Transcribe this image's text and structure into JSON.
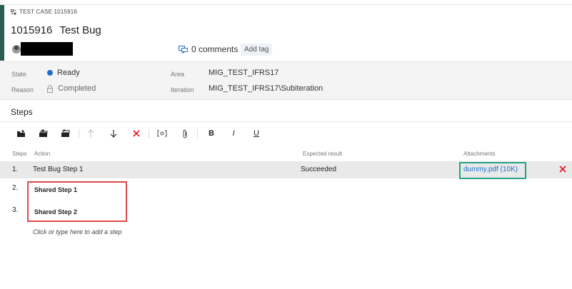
{
  "workitem": {
    "type_label": "TEST CASE 1015916",
    "type_icon": "test-case-icon",
    "id": "1015916",
    "title": "Test Bug",
    "comments": "0 comments",
    "add_tag": "Add tag"
  },
  "fields": {
    "state_label": "State",
    "state_value": "Ready",
    "state_color": "#1e6fc8",
    "reason_label": "Reason",
    "reason_value": "Completed",
    "area_label": "Area",
    "area_value": "MIG_TEST_IFRS17",
    "iteration_label": "Iteration",
    "iteration_value": "MIG_TEST_IFRS17\\Subiteration"
  },
  "steps_section": {
    "title": "Steps",
    "toolbar": [
      {
        "name": "insert-step-icon",
        "enabled": true
      },
      {
        "name": "insert-shared-steps-icon",
        "enabled": true
      },
      {
        "name": "create-shared-steps-icon",
        "enabled": true
      },
      {
        "name": "move-up-icon",
        "enabled": false
      },
      {
        "name": "move-down-icon",
        "enabled": true
      },
      {
        "name": "delete-step-icon",
        "enabled": true
      },
      {
        "name": "parameter-icon",
        "enabled": true
      },
      {
        "name": "attachment-icon",
        "enabled": true
      },
      {
        "name": "bold-icon",
        "label": "B",
        "enabled": true
      },
      {
        "name": "italic-icon",
        "label": "I",
        "enabled": true
      },
      {
        "name": "underline-icon",
        "label": "U",
        "enabled": true
      }
    ],
    "columns": {
      "steps": "Steps",
      "action": "Action",
      "expected": "Expected result",
      "attachments": "Attachments"
    },
    "rows": [
      {
        "num": "1.",
        "action": "Test Bug Step 1",
        "expected": "Succeeded",
        "attachment": "dummy.pdf (10K)"
      },
      {
        "num": "2.",
        "action": "Shared Step 1"
      },
      {
        "num": "3.",
        "action": "Shared Step 2"
      }
    ],
    "add_hint": "Click or type here to add a step"
  },
  "colors": {
    "accent": "#2b5c56",
    "link": "#1e6fc8",
    "highlight_green": "#24a386",
    "highlight_red": "#e04848",
    "delete_red": "#e81123"
  }
}
